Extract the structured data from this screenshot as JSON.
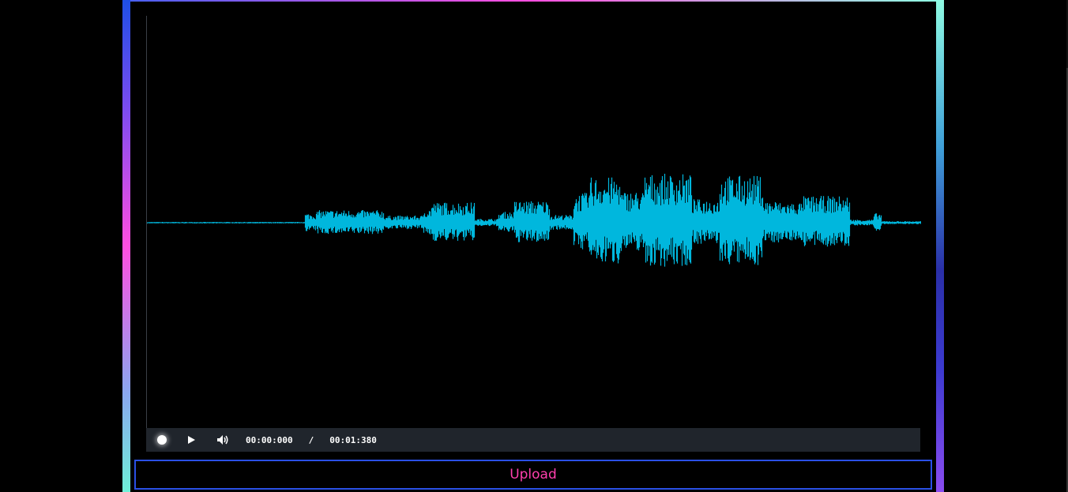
{
  "player": {
    "current_time": "00:00:000",
    "separator": "/",
    "duration": "00:01:380",
    "progress": 0
  },
  "waveform": {
    "color": "#00b7dd",
    "baseline_color": "#2a8aa0"
  },
  "upload_button": {
    "label": "Upload",
    "text_color": "#ff3fae",
    "border_color": "#2a50e6"
  },
  "icons": {
    "seek": "seek-thumb-icon",
    "play": "play-icon",
    "volume": "volume-icon"
  }
}
